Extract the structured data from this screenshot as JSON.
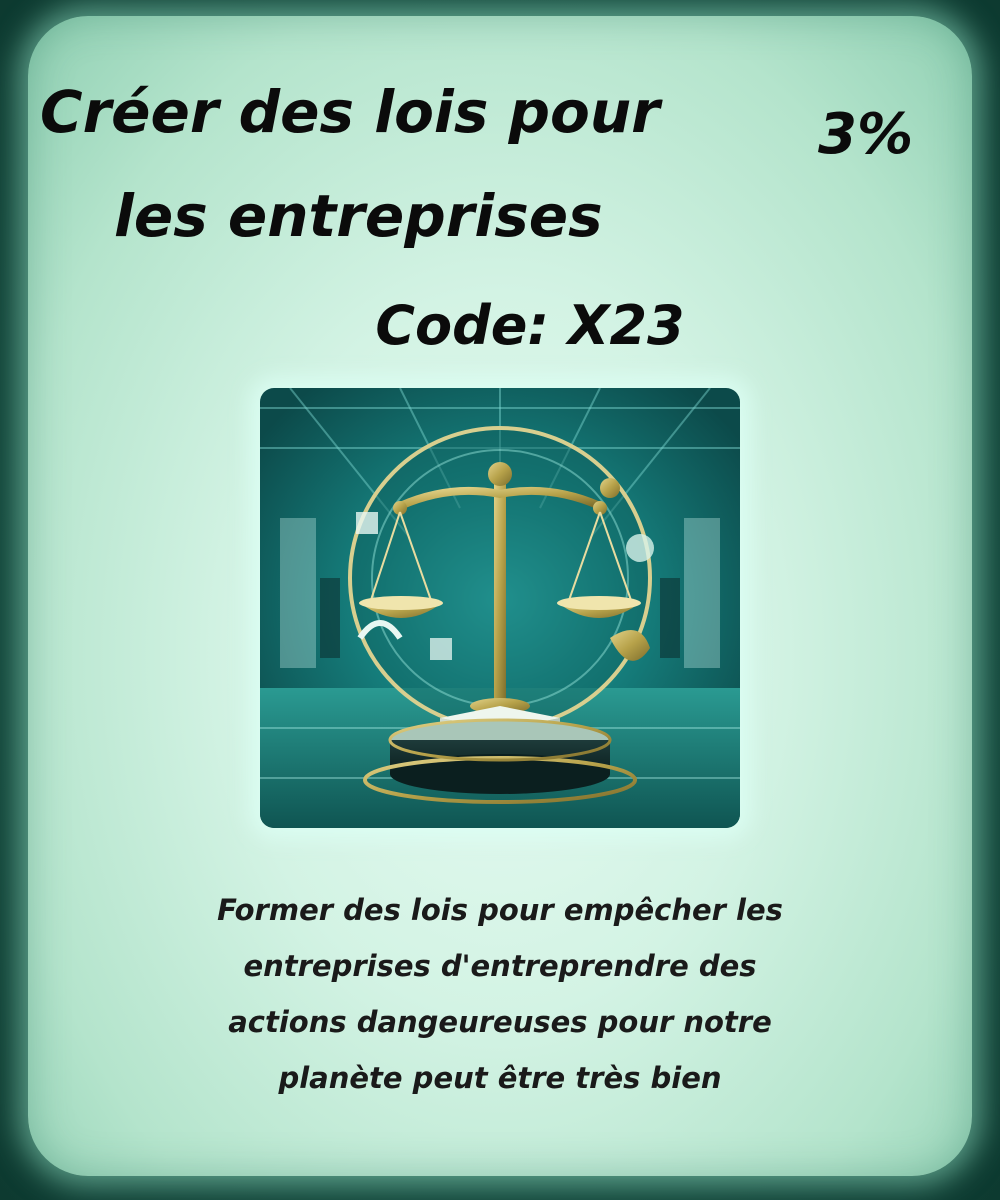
{
  "card": {
    "title_lines": [
      "Créer des lois pour",
      "les entreprises"
    ],
    "percent": "3%",
    "code": "Code: X23",
    "illustration_icon": "scales-of-justice-icon",
    "description_lines": [
      "Former des lois pour empêcher les",
      "entreprises d'entreprendre des",
      "actions dangeureuses pour notre",
      "planète peut être très bien"
    ]
  },
  "colors": {
    "background": "#154c40",
    "card": "#d3f3e4",
    "text": "#0b0b0b",
    "accent_teal": "#1d8f8a",
    "accent_gold": "#b7a24a"
  }
}
